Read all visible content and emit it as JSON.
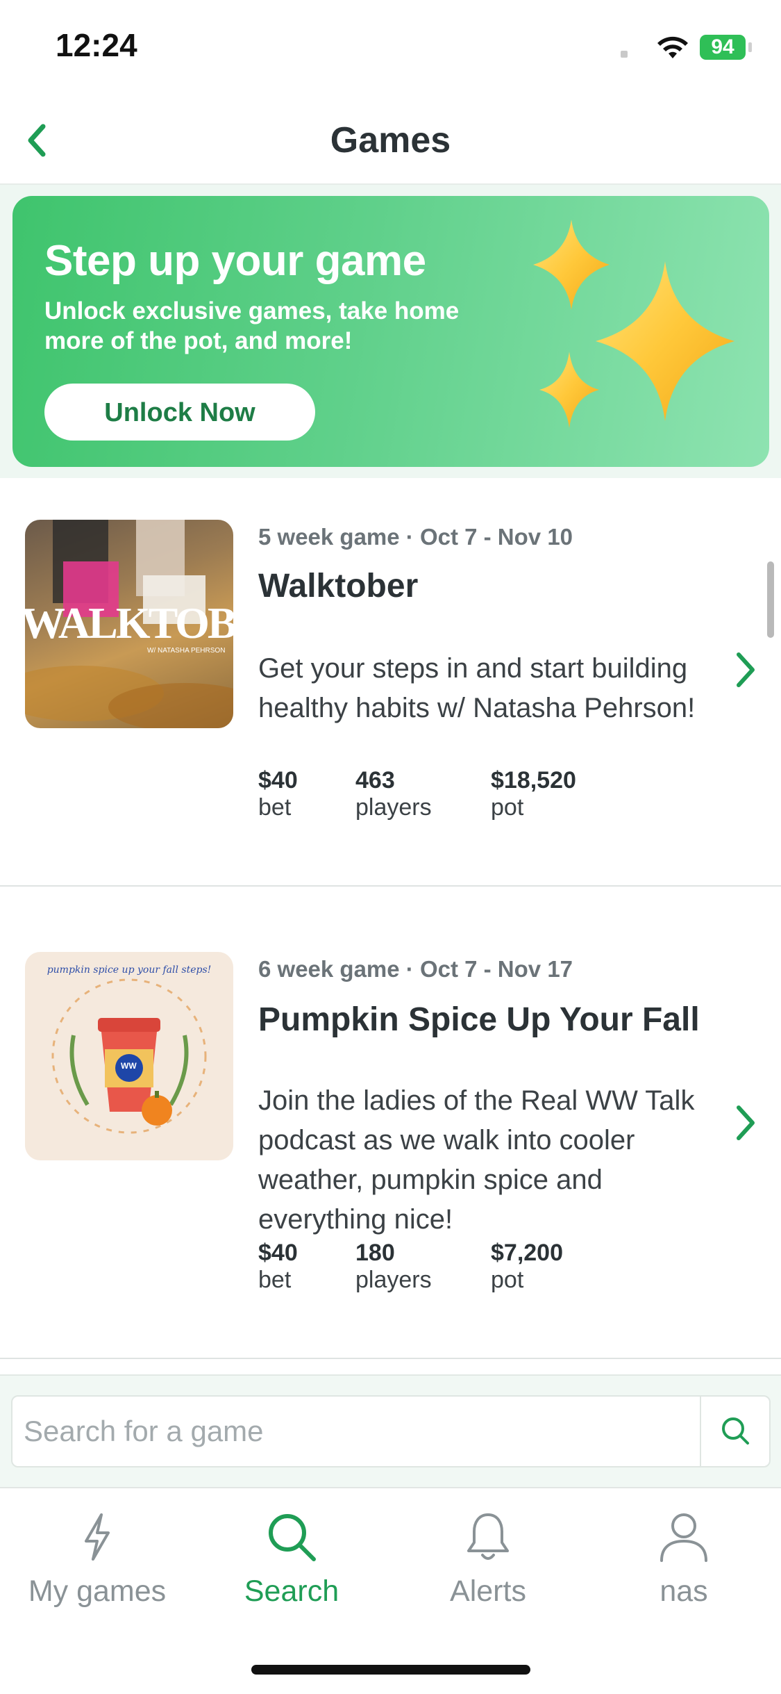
{
  "status_bar": {
    "time": "12:24",
    "battery": "94"
  },
  "header": {
    "title": "Games",
    "back_icon": "chevron-left-icon"
  },
  "promo": {
    "title": "Step up your game",
    "subtitle": "Unlock exclusive games, take home more of the pot, and more!",
    "button_label": "Unlock Now",
    "art_icon": "sparkles-icon"
  },
  "games": [
    {
      "meta": "5 week game · Oct 7 - Nov 10",
      "title": "Walktober",
      "description": "Get your steps in and start building healthy habits w/ Natasha Pehrson!",
      "thumb_text": "WALKTOBER",
      "thumb_subtext": "W/ NATASHA PEHRSON",
      "stats": [
        {
          "value": "$40",
          "label": "bet"
        },
        {
          "value": "463",
          "label": "players"
        },
        {
          "value": "$18,520",
          "label": "pot"
        }
      ]
    },
    {
      "meta": "6 week game · Oct 7 - Nov 17",
      "title": "Pumpkin Spice Up Your Fall",
      "description": "Join the ladies of the Real WW Talk podcast as we walk into cooler weather, pumpkin spice and everything nice!",
      "thumb_text": "pumpkin spice up your fall steps!",
      "thumb_badge": "WW",
      "stats": [
        {
          "value": "$40",
          "label": "bet"
        },
        {
          "value": "180",
          "label": "players"
        },
        {
          "value": "$7,200",
          "label": "pot"
        }
      ]
    }
  ],
  "search": {
    "placeholder": "Search for a game",
    "icon": "search-icon"
  },
  "tabs": [
    {
      "label": "My games",
      "icon": "lightning-icon",
      "active": false
    },
    {
      "label": "Search",
      "icon": "search-icon",
      "active": true
    },
    {
      "label": "Alerts",
      "icon": "bell-icon",
      "active": false
    },
    {
      "label": "nas",
      "icon": "user-icon",
      "active": false
    }
  ],
  "colors": {
    "accent": "#1f9d55",
    "promo_green": "#4cc878",
    "text": "#2b3236",
    "muted": "#8a9296"
  }
}
